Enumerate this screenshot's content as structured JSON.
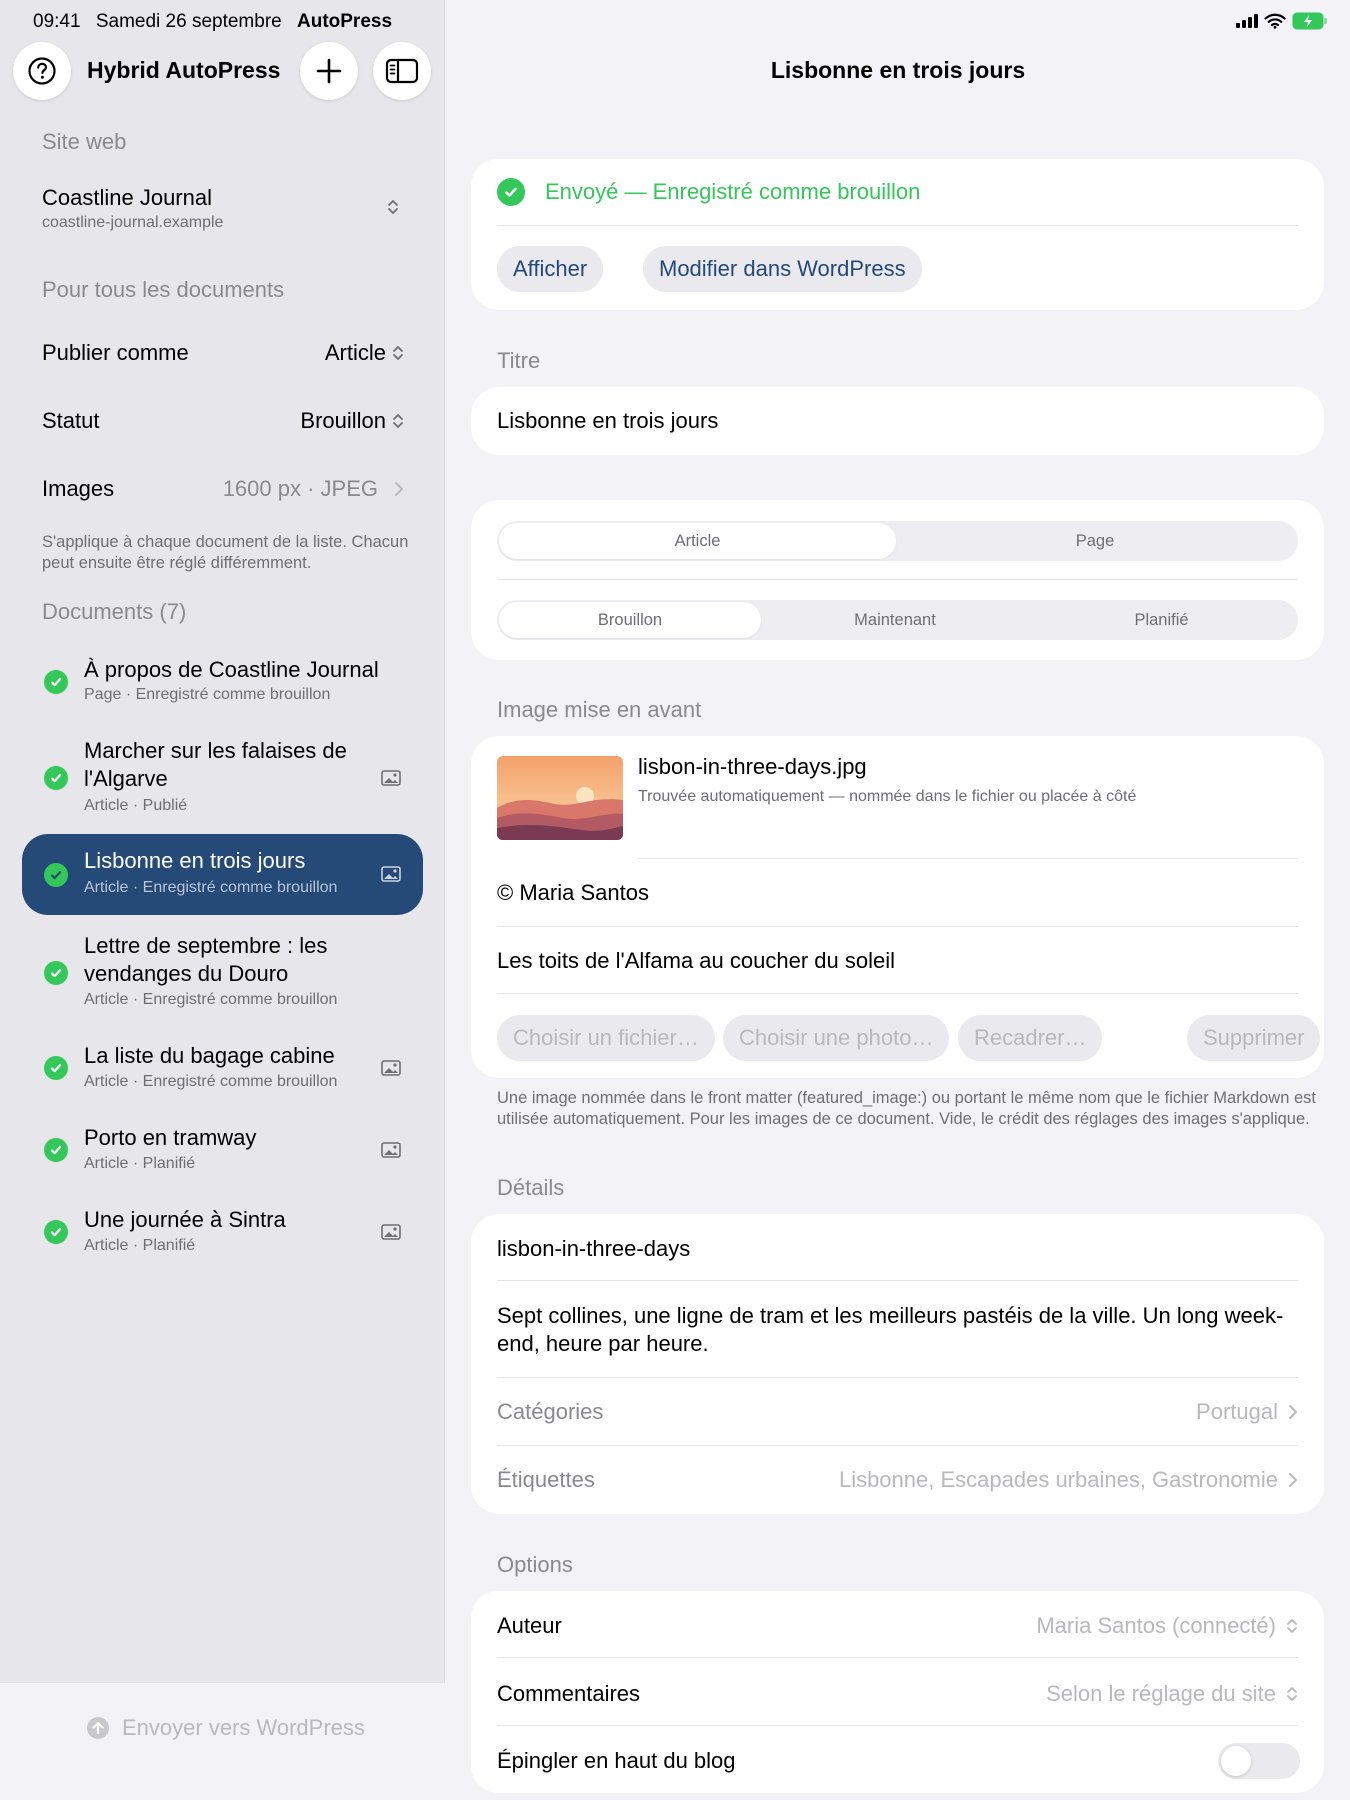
{
  "status_bar": {
    "time": "09:41",
    "date": "Samedi 26 septembre",
    "app": "AutoPress"
  },
  "sidebar": {
    "app_title": "Hybrid AutoPress",
    "site_section_label": "Site web",
    "site_name": "Coastline Journal",
    "site_url": "coastline-journal.example",
    "all_docs_label": "Pour tous les documents",
    "publish_as_label": "Publier comme",
    "publish_as_value": "Article",
    "status_label": "Statut",
    "status_value": "Brouillon",
    "images_label": "Images",
    "images_value": "1600 px · JPEG",
    "apply_note": "S'applique à chaque document de la liste. Chacun peut ensuite être réglé différemment.",
    "documents_label": "Documents (7)",
    "documents": [
      {
        "title": "À propos de Coastline Journal",
        "subtitle": "Page · Enregistré comme brouillon",
        "has_image": false,
        "active": false
      },
      {
        "title": "Marcher sur les falaises de l'Algarve",
        "subtitle": "Article · Publié",
        "has_image": true,
        "active": false
      },
      {
        "title": "Lisbonne en trois jours",
        "subtitle": "Article · Enregistré comme brouillon",
        "has_image": true,
        "active": true
      },
      {
        "title": "Lettre de septembre : les vendanges du Douro",
        "subtitle": "Article · Enregistré comme brouillon",
        "has_image": false,
        "active": false
      },
      {
        "title": "La liste du bagage cabine",
        "subtitle": "Article · Enregistré comme brouillon",
        "has_image": true,
        "active": false
      },
      {
        "title": "Porto en tramway",
        "subtitle": "Article · Planifié",
        "has_image": true,
        "active": false
      },
      {
        "title": "Une journée à Sintra",
        "subtitle": "Article · Planifié",
        "has_image": true,
        "active": false
      }
    ],
    "send_label": "Envoyer vers WordPress"
  },
  "main": {
    "nav_title": "Lisbonne en trois jours",
    "sent_status": "Envoyé — Enregistré comme brouillon",
    "view_button": "Afficher",
    "edit_button": "Modifier dans WordPress",
    "title_section": "Titre",
    "title_value": "Lisbonne en trois jours",
    "type_options": [
      "Article",
      "Page"
    ],
    "type_selected": "Article",
    "publish_options": [
      "Brouillon",
      "Maintenant",
      "Planifié"
    ],
    "publish_selected": "Brouillon",
    "featured_section": "Image mise en avant",
    "featured_filename": "lisbon-in-three-days.jpg",
    "featured_found": "Trouvée automatiquement — nommée dans le fichier ou placée à côté",
    "featured_credit": "© Maria Santos",
    "featured_caption": "Les toits de l'Alfama au coucher du soleil",
    "choose_file": "Choisir un fichier…",
    "choose_photo": "Choisir une photo…",
    "recrop": "Recadrer…",
    "remove": "Supprimer",
    "image_note": "Une image nommée dans le front matter (featured_image:) ou portant le même nom que le fichier Markdown est utilisée automatiquement. Pour les images de ce document. Vide, le crédit des réglages des images s'applique.",
    "details_section": "Détails",
    "slug": "lisbon-in-three-days",
    "excerpt": "Sept collines, une ligne de tram et les meilleurs pastéis de la ville. Un long week-end, heure par heure.",
    "categories_label": "Catégories",
    "categories_value": "Portugal",
    "tags_label": "Étiquettes",
    "tags_value": "Lisbonne, Escapades urbaines, Gastronomie",
    "options_section": "Options",
    "author_label": "Auteur",
    "author_value": "Maria Santos (connecté)",
    "comments_label": "Commentaires",
    "comments_value": "Selon le réglage du site",
    "pin_label": "Épingler en haut du blog",
    "pin_on": false
  },
  "colors": {
    "accent": "#254a78",
    "success": "#34c759",
    "background": "#f2f2f7",
    "sidebar": "#e6e6eb"
  },
  "icons": {
    "help": "question-circle-icon",
    "add": "plus-icon",
    "sidebar": "sidebar-toggle-icon",
    "image": "photo-icon",
    "check": "checkmark-circle-icon",
    "send": "arrow-up-circle-icon"
  }
}
